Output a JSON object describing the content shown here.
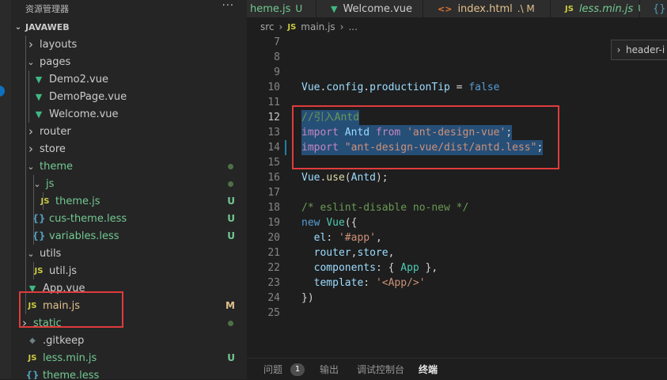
{
  "sidebar": {
    "title": "资源管理器",
    "more": "···",
    "section": "JAVAWEB",
    "items": [
      {
        "type": "folder",
        "label": "layouts",
        "open": false,
        "status": "",
        "color": "default"
      },
      {
        "type": "folder",
        "label": "pages",
        "open": true,
        "status": "",
        "color": "default"
      },
      {
        "type": "vue",
        "label": "Demo2.vue",
        "status": "",
        "color": "default"
      },
      {
        "type": "vue",
        "label": "DemoPage.vue",
        "status": "",
        "color": "default"
      },
      {
        "type": "vue",
        "label": "Welcome.vue",
        "status": "",
        "color": "default"
      },
      {
        "type": "folder",
        "label": "router",
        "open": false,
        "status": "",
        "color": "default"
      },
      {
        "type": "folder",
        "label": "store",
        "open": false,
        "status": "",
        "color": "default"
      },
      {
        "type": "folder",
        "label": "theme",
        "open": true,
        "status": "dot",
        "color": "untracked"
      },
      {
        "type": "folder",
        "label": "js",
        "open": true,
        "status": "dot",
        "color": "untracked"
      },
      {
        "type": "js",
        "label": "theme.js",
        "status": "U",
        "color": "untracked"
      },
      {
        "type": "less",
        "label": "cus-theme.less",
        "status": "U",
        "color": "untracked"
      },
      {
        "type": "less",
        "label": "variables.less",
        "status": "U",
        "color": "untracked"
      },
      {
        "type": "folder",
        "label": "utils",
        "open": true,
        "status": "",
        "color": "default"
      },
      {
        "type": "js",
        "label": "util.js",
        "status": "",
        "color": "default"
      },
      {
        "type": "vue",
        "label": "App.vue",
        "status": "",
        "color": "default"
      },
      {
        "type": "js",
        "label": "main.js",
        "status": "M",
        "color": "modified"
      },
      {
        "type": "folder",
        "label": "static",
        "open": false,
        "status": "dot",
        "color": "untracked"
      },
      {
        "type": "git",
        "label": ".gitkeep",
        "status": "",
        "color": "default"
      },
      {
        "type": "js",
        "label": "less.min.js",
        "status": "U",
        "color": "untracked"
      },
      {
        "type": "less",
        "label": "theme.less",
        "status": "",
        "color": "untracked"
      }
    ]
  },
  "tabs": [
    {
      "label": "heme.js",
      "status": "U",
      "icon": "",
      "color": "untracked"
    },
    {
      "label": "Welcome.vue",
      "status": "",
      "icon": "vue",
      "color": "default"
    },
    {
      "label": "index.html",
      "status": ".\\ M",
      "icon": "html",
      "color": "modified"
    },
    {
      "label": "less.min.js",
      "status": "U",
      "icon": "js",
      "color": "untracked"
    },
    {
      "label": "{}",
      "status": "",
      "icon": "",
      "color": "default"
    }
  ],
  "breadcrumb": {
    "src": "src",
    "sep1": "›",
    "js": "JS",
    "file": "main.js",
    "sep2": "›",
    "more": "..."
  },
  "peek": {
    "label": "header-i"
  },
  "editor": {
    "lines": [
      {
        "n": "7",
        "tokens": []
      },
      {
        "n": "8",
        "tokens": []
      },
      {
        "n": "9",
        "tokens": []
      },
      {
        "n": "10",
        "tokens": [
          [
            "ident",
            "Vue"
          ],
          [
            "pl",
            "."
          ],
          [
            "ident",
            "config"
          ],
          [
            "pl",
            "."
          ],
          [
            "ident",
            "productionTip"
          ],
          [
            "pl",
            " = "
          ],
          [
            "kw",
            "false"
          ]
        ]
      },
      {
        "n": "11",
        "tokens": []
      },
      {
        "n": "12",
        "tokens": [
          [
            "cmt",
            "//引入Antd"
          ]
        ],
        "sel": true,
        "active": true
      },
      {
        "n": "13",
        "tokens": [
          [
            "kw2",
            "import"
          ],
          [
            "pl",
            " "
          ],
          [
            "ident",
            "Antd"
          ],
          [
            "pl",
            " "
          ],
          [
            "kw2",
            "from"
          ],
          [
            "pl",
            " "
          ],
          [
            "str",
            "'ant-design-vue'"
          ],
          [
            "pl",
            ";"
          ]
        ],
        "sel": true
      },
      {
        "n": "14",
        "tokens": [
          [
            "kw2",
            "import"
          ],
          [
            "pl",
            " "
          ],
          [
            "str",
            "\"ant-design-vue/dist/antd.less\""
          ],
          [
            "pl",
            ";"
          ]
        ],
        "sel": true,
        "mod": true
      },
      {
        "n": "15",
        "tokens": []
      },
      {
        "n": "16",
        "tokens": [
          [
            "ident",
            "Vue"
          ],
          [
            "pl",
            "."
          ],
          [
            "fn",
            "use"
          ],
          [
            "pl",
            "("
          ],
          [
            "ident",
            "Antd"
          ],
          [
            "pl",
            ");"
          ]
        ]
      },
      {
        "n": "17",
        "tokens": []
      },
      {
        "n": "18",
        "tokens": [
          [
            "cmt",
            "/* eslint-disable no-new */"
          ]
        ]
      },
      {
        "n": "19",
        "tokens": [
          [
            "kw",
            "new"
          ],
          [
            "pl",
            " "
          ],
          [
            "cls",
            "Vue"
          ],
          [
            "pl",
            "({"
          ]
        ]
      },
      {
        "n": "20",
        "tokens": [
          [
            "pl",
            "  "
          ],
          [
            "ident",
            "el"
          ],
          [
            "pl",
            ": "
          ],
          [
            "str",
            "'#app'"
          ],
          [
            "pl",
            ","
          ]
        ]
      },
      {
        "n": "21",
        "tokens": [
          [
            "pl",
            "  "
          ],
          [
            "ident",
            "router"
          ],
          [
            "pl",
            ","
          ],
          [
            "ident",
            "store"
          ],
          [
            "pl",
            ","
          ]
        ]
      },
      {
        "n": "22",
        "tokens": [
          [
            "pl",
            "  "
          ],
          [
            "ident",
            "components"
          ],
          [
            "pl",
            ": { "
          ],
          [
            "cls",
            "App"
          ],
          [
            "pl",
            " },"
          ]
        ]
      },
      {
        "n": "23",
        "tokens": [
          [
            "pl",
            "  "
          ],
          [
            "ident",
            "template"
          ],
          [
            "pl",
            ": "
          ],
          [
            "str",
            "'<App/>'"
          ]
        ]
      },
      {
        "n": "24",
        "tokens": [
          [
            "pl",
            "})"
          ]
        ]
      },
      {
        "n": "25",
        "tokens": []
      }
    ]
  },
  "panel": {
    "tabs": [
      {
        "label": "问题",
        "badge": "1",
        "active": false
      },
      {
        "label": "输出",
        "active": false
      },
      {
        "label": "调试控制台",
        "active": false
      },
      {
        "label": "终端",
        "active": true
      }
    ]
  },
  "colors": {
    "modified": "#e2c08d",
    "untracked": "#73c991",
    "default": "#cccccc",
    "highlight_box": "#e03b3b",
    "selection": "#264f78"
  }
}
